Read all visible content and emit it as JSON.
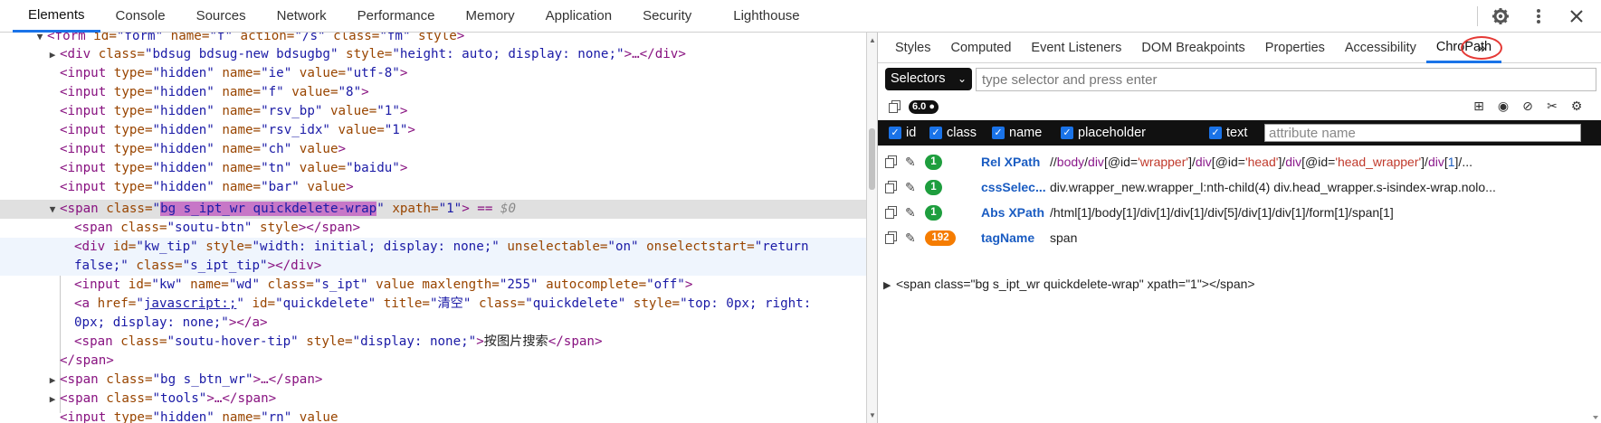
{
  "toptabs": [
    "Elements",
    "Console",
    "Sources",
    "Network",
    "Performance",
    "Memory",
    "Application",
    "Security",
    "Lighthouse"
  ],
  "tree": {
    "l0_tag": "<form",
    "l0_a1": " id=",
    "l0_v1": "\"form\"",
    "l0_a2": " name=",
    "l0_v2": "\"f\"",
    "l0_a3": " action=",
    "l0_v3": "\"/s\"",
    "l0_a4": " class=",
    "l0_v4": "\"fm\"",
    "l0_a5": " style",
    "l0_end": ">",
    "l1_tag": "<div",
    "l1_a1": " class=",
    "l1_v1": "\"bdsug bdsug-new bdsugbg\"",
    "l1_a2": " style=",
    "l1_v2": "\"height: auto; display: none;\"",
    "l1_end": ">…</div>",
    "inputs": [
      {
        "name": "\"ie\"",
        "value": "\"utf-8\""
      },
      {
        "name": "\"f\"",
        "value": "\"8\""
      },
      {
        "name": "\"rsv_bp\"",
        "value": "\"1\""
      },
      {
        "name": "\"rsv_idx\"",
        "value": "\"1\""
      },
      {
        "name": "\"ch\"",
        "value": ""
      },
      {
        "name": "\"tn\"",
        "value": "\"baidu\""
      },
      {
        "name": "\"bar\"",
        "value": ""
      }
    ],
    "input_tag": "<input",
    "input_type": " type=",
    "input_hidden": "\"hidden\"",
    "input_name": " name=",
    "input_value": " value",
    "input_value_eq": "=",
    "input_end": ">",
    "sel_tag": "<span",
    "sel_a1": " class=",
    "sel_q": "\"",
    "sel_v1": "bg s_ipt_wr quickdelete-wrap",
    "sel_a2": " xpath=",
    "sel_v2": "\"1\"",
    "sel_end": "> == ",
    "sel_dollar": "$0",
    "c1_tag": "<span",
    "c1_a1": " class=",
    "c1_v1": "\"soutu-btn\"",
    "c1_a2": " style",
    "c1_end": "></span>",
    "c2_tag": "<div",
    "c2_a1": " id=",
    "c2_v1": "\"kw_tip\"",
    "c2_a2": " style=",
    "c2_v2": "\"width: initial; display: none;\"",
    "c2_a3": " unselectable=",
    "c2_v3": "\"on\"",
    "c2_a4": " onselectstart=",
    "c2_v4a": "\"return",
    "c2_v4b": "false;\"",
    "c2_a5": " class=",
    "c2_v5": "\"s_ipt_tip\"",
    "c2_end": "></div>",
    "c3_tag": "<input",
    "c3_a1": " id=",
    "c3_v1": "\"kw\"",
    "c3_a2": " name=",
    "c3_v2": "\"wd\"",
    "c3_a3": " class=",
    "c3_v3": "\"s_ipt\"",
    "c3_a4": " value maxlength=",
    "c3_v4": "\"255\"",
    "c3_a5": " autocomplete=",
    "c3_v5": "\"off\"",
    "c3_end": ">",
    "c4_tag": "<a",
    "c4_a1": " href=",
    "c4_q1": "\"",
    "c4_link": "javascript:;",
    "c4_q2": "\"",
    "c4_a2": " id=",
    "c4_v2": "\"quickdelete\"",
    "c4_a3": " title=",
    "c4_v3": "\"清空\"",
    "c4_a4": " class=",
    "c4_v4": "\"quickdelete\"",
    "c4_a5": " style=",
    "c4_v5a": "\"top: 0px; right:",
    "c4_v5b": "0px; display: none;\"",
    "c4_end": "></a>",
    "c5_tag": "<span",
    "c5_a1": " class=",
    "c5_v1": "\"soutu-hover-tip\"",
    "c5_a2": " style=",
    "c5_v2": "\"display: none;\"",
    "c5_mid": ">",
    "c5_text": "按图片搜索",
    "c5_end": "</span>",
    "close_span": "</span>",
    "s2_tag": "<span",
    "s2_a1": " class=",
    "s2_v1": "\"bg s_btn_wr\"",
    "s2_end": ">…</span>",
    "s3_tag": "<span",
    "s3_a1": " class=",
    "s3_v1": "\"tools\"",
    "s3_end": ">…</span>",
    "last_tag": "<input",
    "last_a1": " type=",
    "last_v1": "\"hidden\"",
    "last_a2": " name=",
    "last_v2": "\"rn\"",
    "last_a3": " value"
  },
  "rtabs": [
    "Styles",
    "Computed",
    "Event Listeners",
    "DOM Breakpoints",
    "Properties",
    "Accessibility",
    "ChroPath"
  ],
  "more_label": "»",
  "chropath": {
    "selector_label": "Selectors",
    "selector_placeholder": "type selector and press enter",
    "version": "6.0",
    "checkboxes": [
      "id",
      "class",
      "name",
      "placeholder",
      "text"
    ],
    "attr_placeholder": "attribute name",
    "results": [
      {
        "count": "1",
        "label": "Rel XPath"
      },
      {
        "count": "1",
        "label": "cssSelec...",
        "value": "div.wrapper_new.wrapper_l:nth-child(4) div.head_wrapper.s-isindex-wrap.nolo..."
      },
      {
        "count": "1",
        "label": "Abs XPath",
        "value": "/html[1]/body[1]/div[1]/div[1]/div[5]/div[1]/div[1]/form[1]/span[1]"
      },
      {
        "count": "192",
        "label": "tagName",
        "value": "span"
      }
    ],
    "relxpath": {
      "p1": "//",
      "p2": "body",
      "p3": "/",
      "p4": "div",
      "p5": "[@id=",
      "p6": "'wrapper'",
      "p7": "]/",
      "p8": "div",
      "p9": "[@id=",
      "p10": "'head'",
      "p11": "]/",
      "p12": "div",
      "p13": "[@id=",
      "p14": "'head_wrapper'",
      "p15": "]/",
      "p16": "div",
      "p17": "[",
      "p18": "1",
      "p19": "]/..."
    },
    "node_html": "<span class=\"bg s_ipt_wr quickdelete-wrap\" xpath=\"1\"></span>"
  },
  "colors": {
    "accent": "#1a73e8",
    "badge_green": "#1e9e3e",
    "badge_orange": "#f57c00",
    "highlight": "#c777c7",
    "annotation_red": "#e53935"
  }
}
